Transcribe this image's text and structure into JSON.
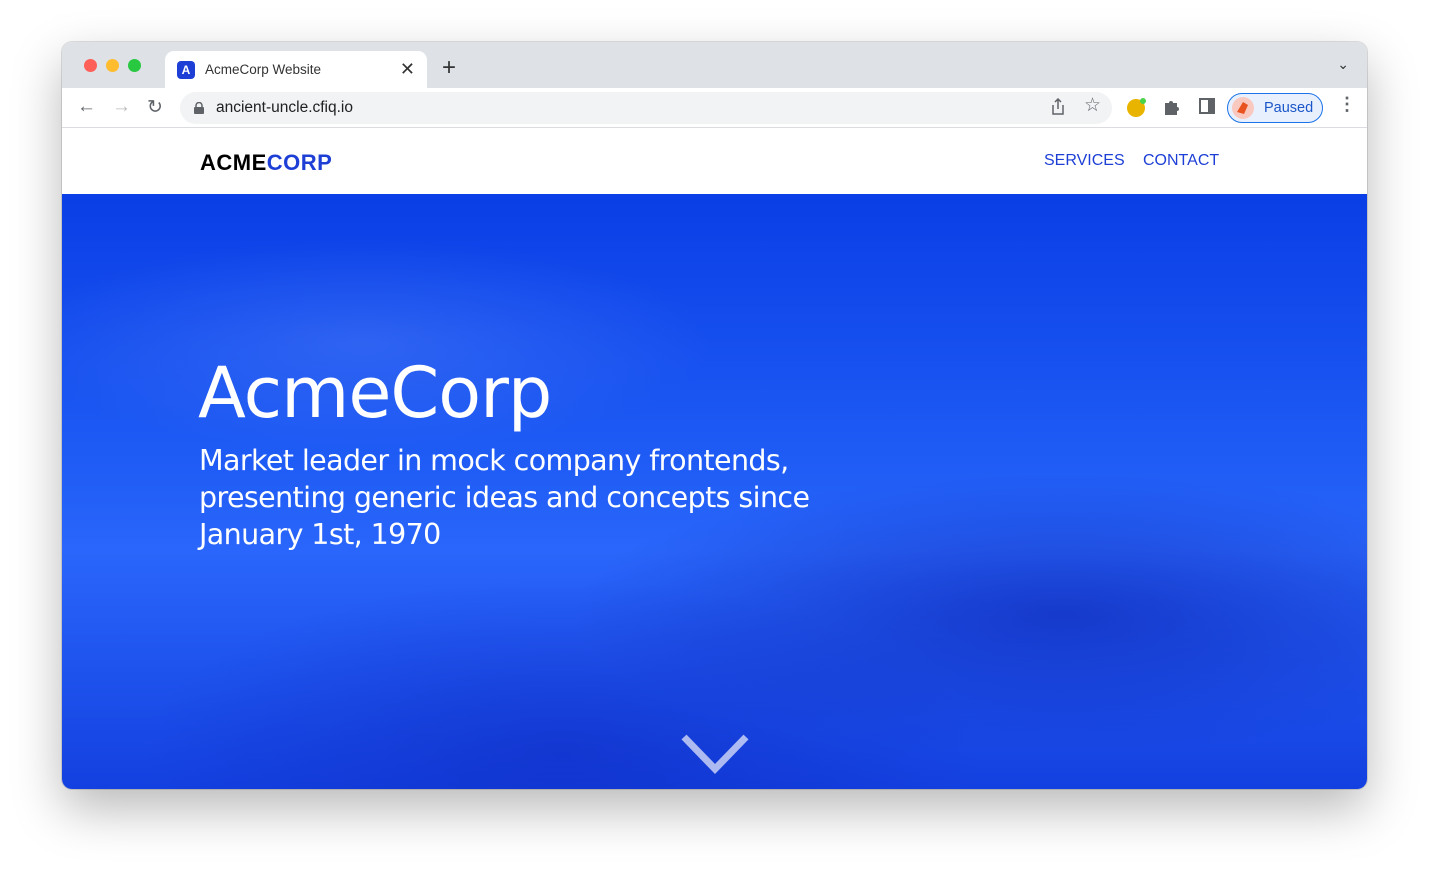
{
  "browser": {
    "tab_title": "AcmeCorp Website",
    "favicon_letter": "A",
    "url": "ancient-uncle.cfiq.io",
    "profile_status": "Paused"
  },
  "site": {
    "logo_part1": "ACME",
    "logo_part2": "CORP",
    "nav": [
      {
        "label": "SERVICES"
      },
      {
        "label": "CONTACT"
      }
    ],
    "hero": {
      "title": "AcmeCorp",
      "subtitle": "Market leader in mock company frontends, presenting generic ideas and concepts since January 1st, 1970"
    }
  },
  "colors": {
    "brand": "#1d3fd6",
    "hero": "#1f5cf5"
  }
}
